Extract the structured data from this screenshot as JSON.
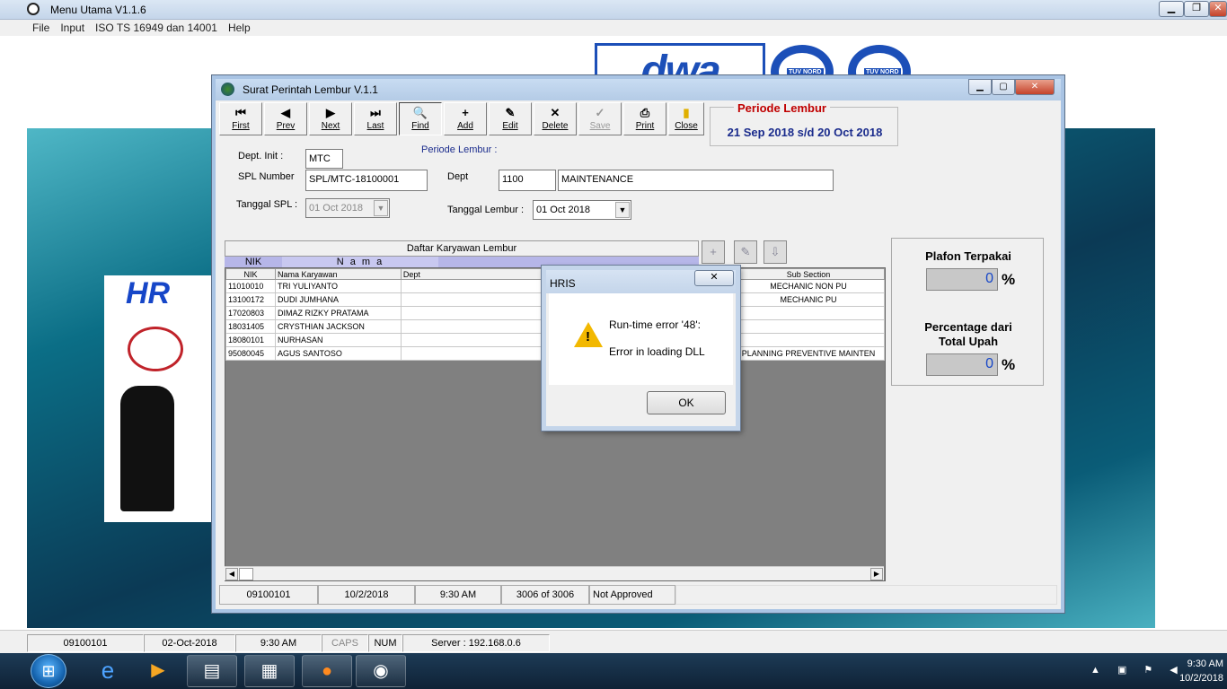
{
  "main": {
    "title": "Menu Utama V1.1.6",
    "menu": [
      "File",
      "Input",
      "ISO TS 16949 dan 14001",
      "Help"
    ],
    "logo_text": "dwa",
    "tuv_label": "TUV NORD",
    "hr_label": "HR"
  },
  "child": {
    "title": "Surat Perintah Lembur V.1.1",
    "toolbar": [
      {
        "glyph": "⏮",
        "label": "First",
        "enabled": true
      },
      {
        "glyph": "◀",
        "label": "Prev",
        "enabled": true
      },
      {
        "glyph": "▶",
        "label": "Next",
        "enabled": true
      },
      {
        "glyph": "⏭",
        "label": "Last",
        "enabled": true
      },
      {
        "glyph": "🔍",
        "label": "Find",
        "enabled": true
      },
      {
        "glyph": "+",
        "label": "Add",
        "enabled": true
      },
      {
        "glyph": "✎",
        "label": "Edit",
        "enabled": true
      },
      {
        "glyph": "✕",
        "label": "Delete",
        "enabled": true
      },
      {
        "glyph": "✓",
        "label": "Save",
        "enabled": false
      },
      {
        "glyph": "⎙",
        "label": "Print",
        "enabled": true
      },
      {
        "glyph": "▮",
        "label": "Close",
        "enabled": true
      }
    ],
    "periode": {
      "title": "Periode Lembur",
      "value": "21 Sep 2018  s/d  20 Oct 2018",
      "inline_label": "Periode Lembur :"
    },
    "form": {
      "dept_init_label": "Dept. Init :",
      "dept_init": "MTC",
      "spl_number_label": "SPL Number",
      "spl_number": "SPL/MTC-18100001",
      "dept_label": "Dept",
      "dept_code": "1100",
      "dept_name": "MAINTENANCE",
      "tanggal_spl_label": "Tanggal SPL :",
      "tanggal_spl": "01 Oct 2018",
      "tanggal_lembur_label": "Tanggal Lembur :",
      "tanggal_lembur": "01 Oct 2018"
    },
    "grid": {
      "caption": "Daftar Karyawan  Lembur",
      "sub_headers": [
        "NIK",
        "N a m a"
      ],
      "columns": [
        "NIK",
        "Nama Karyawan",
        "Dept",
        "Sub Section"
      ],
      "rows": [
        {
          "nik": "11010010",
          "nama": "TRI YULIYANTO",
          "dept": "",
          "sub": "MECHANIC NON PU"
        },
        {
          "nik": "13100172",
          "nama": "DUDI JUMHANA",
          "dept": "",
          "sub": "MECHANIC PU"
        },
        {
          "nik": "17020803",
          "nama": "DIMAZ RIZKY PRATAMA",
          "dept": "",
          "sub": ""
        },
        {
          "nik": "18031405",
          "nama": "CRYSTHIAN JACKSON",
          "dept": "",
          "sub": ""
        },
        {
          "nik": "18080101",
          "nama": "NURHASAN",
          "dept": "",
          "sub": ""
        },
        {
          "nik": "95080045",
          "nama": "AGUS SANTOSO",
          "dept": "",
          "sub": "PLANNING PREVENTIVE MAINTEN"
        }
      ]
    },
    "right_panel": {
      "plafon_label": "Plafon Terpakai",
      "plafon_value": "0",
      "plafon_unit": "%",
      "pct_label_1": "Percentage dari",
      "pct_label_2": "Total Upah",
      "pct_value": "0",
      "pct_unit": "%"
    },
    "status": [
      "09100101",
      "10/2/2018",
      "9:30 AM",
      "3006 of 3006",
      "Not Approved"
    ]
  },
  "dialog": {
    "title": "HRIS",
    "line1": "Run-time error '48':",
    "line2": "Error in loading DLL",
    "ok": "OK"
  },
  "statusbar": [
    "09100101",
    "02-Oct-2018",
    "9:30 AM",
    "CAPS",
    "NUM",
    "Server : 192.168.0.6"
  ],
  "taskbar": {
    "time": "9:30 AM",
    "date": "10/2/2018"
  },
  "colors": {
    "periode_title": "#c00000",
    "periode_value": "#1a2b8c",
    "value_blue": "#1646c8"
  }
}
